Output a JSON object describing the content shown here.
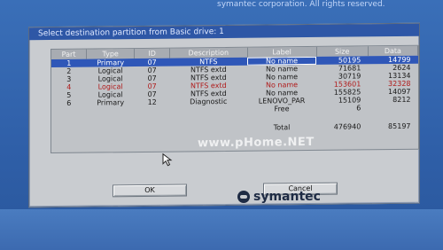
{
  "top_text": "symantec corporation. All rights reserved.",
  "dialog": {
    "title": "Select destination partition from Basic drive: 1",
    "columns": [
      "Part",
      "Type",
      "ID",
      "Description",
      "Label",
      "Size",
      "Data"
    ],
    "rows": [
      {
        "part": "1",
        "type": "Primary",
        "id": "07",
        "description": "NTFS",
        "label": "No name",
        "size": "50195",
        "data": "14799",
        "selected": true
      },
      {
        "part": "2",
        "type": "Logical",
        "id": "07",
        "description": "NTFS extd",
        "label": "No name",
        "size": "71681",
        "data": "2624"
      },
      {
        "part": "3",
        "type": "Logical",
        "id": "07",
        "description": "NTFS extd",
        "label": "No name",
        "size": "30719",
        "data": "13134"
      },
      {
        "part": "4",
        "type": "Logical",
        "id": "07",
        "description": "NTFS extd",
        "label": "No name",
        "size": "153601",
        "data": "32328",
        "red": true
      },
      {
        "part": "5",
        "type": "Logical",
        "id": "07",
        "description": "NTFS extd",
        "label": "No name",
        "size": "155825",
        "data": "14097"
      },
      {
        "part": "6",
        "type": "Primary",
        "id": "12",
        "description": "Diagnostic",
        "label": "LENOVO_PAR",
        "size": "15109",
        "data": "8212"
      },
      {
        "part": "",
        "type": "",
        "id": "",
        "description": "",
        "label": "Free",
        "size": "6",
        "data": ""
      }
    ],
    "total": {
      "label": "Total",
      "size": "476940",
      "data": "85197"
    },
    "watermark": "www.pHome.NET",
    "buttons": {
      "ok": "OK",
      "cancel": "Cancel"
    }
  },
  "brand": "symantec",
  "colors": {
    "selected_row": "#2f57b8",
    "title_bar": "#2e57a6",
    "red_text": "#b01b1b"
  }
}
